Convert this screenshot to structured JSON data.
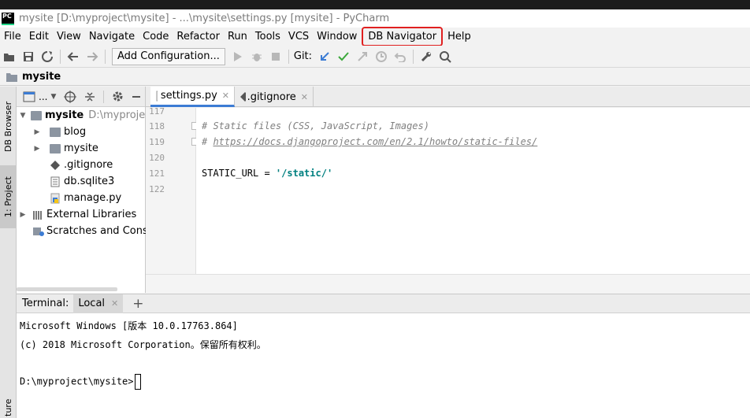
{
  "window": {
    "title": "mysite [D:\\myproject\\mysite] - ...\\mysite\\settings.py [mysite] - PyCharm",
    "logo_text": "PC"
  },
  "menu": [
    "File",
    "Edit",
    "View",
    "Navigate",
    "Code",
    "Refactor",
    "Run",
    "Tools",
    "VCS",
    "Window",
    "DB Navigator",
    "Help"
  ],
  "toolbar": {
    "add_config_label": "Add Configuration...",
    "git_label": "Git:"
  },
  "breadcrumb": {
    "root": "mysite"
  },
  "left_tabs": {
    "db_browser": "DB Browser",
    "project": "1: Project",
    "structure": "ture"
  },
  "project_panel": {
    "dropdown_label": "..."
  },
  "tree": [
    {
      "label": "mysite",
      "suffix": "D:\\myproject",
      "bold": true
    },
    {
      "label": "blog"
    },
    {
      "label": "mysite"
    },
    {
      "label": ".gitignore"
    },
    {
      "label": "db.sqlite3"
    },
    {
      "label": "manage.py"
    },
    {
      "label": "External Libraries"
    },
    {
      "label": "Scratches and Conso"
    }
  ],
  "editor_tabs": [
    {
      "label": "settings.py"
    },
    {
      "label": ".gitignore"
    }
  ],
  "code_lines": [
    {
      "num": "117",
      "text": ""
    },
    {
      "num": "118",
      "text": "# Static files (CSS, JavaScript, Images)"
    },
    {
      "num": "119",
      "text_prefix": "# ",
      "link": "https://docs.djangoproject.com/en/2.1/howto/static-files/"
    },
    {
      "num": "120",
      "text": ""
    },
    {
      "num": "121",
      "code": "STATIC_URL = ",
      "string": "'/static/'"
    },
    {
      "num": "122",
      "text": ""
    }
  ],
  "terminal": {
    "title": "Terminal:",
    "tab_label": "Local",
    "lines": [
      "Microsoft Windows [版本 10.0.17763.864]",
      "(c) 2018 Microsoft Corporation。保留所有权利。",
      "",
      "D:\\myproject\\mysite>"
    ]
  },
  "colors": {
    "highlight_box": "#e02020",
    "active_tab_underline": "#3c7cd4",
    "string_color": "#008080",
    "comment_color": "#808080"
  }
}
